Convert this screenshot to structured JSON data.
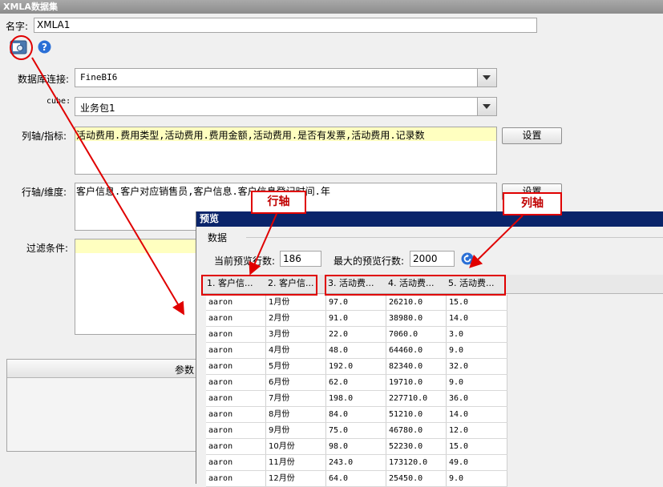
{
  "window": {
    "title": "XMLA数据集"
  },
  "name_field": {
    "label": "名字:",
    "value": "XMLA1"
  },
  "form": {
    "db_label": "数据库连接:",
    "db_value": "FineBI6",
    "cube_label": "cube:",
    "cube_value": "业务包1",
    "columns_label": "列轴/指标:",
    "columns_value": "活动费用.费用类型,活动费用.费用金额,活动费用.是否有发票,活动费用.记录数",
    "rows_label": "行轴/维度:",
    "rows_value": "客户信息.客户对应销售员,客户信息.客户信息登记时间.年",
    "filter_label": "过滤条件:",
    "settings_label": "设置",
    "params_label": "参数"
  },
  "preview": {
    "title": "预览",
    "group_label": "数据",
    "current_rows_label": "当前预览行数:",
    "current_rows_value": "186",
    "max_rows_label": "最大的预览行数:",
    "max_rows_value": "2000",
    "columns": [
      "1. 客户信...",
      "2. 客户信...",
      "3. 活动费...",
      "4. 活动费...",
      "5. 活动费..."
    ],
    "rows": [
      [
        "aaron",
        "1月份",
        "97.0",
        "26210.0",
        "15.0"
      ],
      [
        "aaron",
        "2月份",
        "91.0",
        "38980.0",
        "14.0"
      ],
      [
        "aaron",
        "3月份",
        "22.0",
        "7060.0",
        "3.0"
      ],
      [
        "aaron",
        "4月份",
        "48.0",
        "64460.0",
        "9.0"
      ],
      [
        "aaron",
        "5月份",
        "192.0",
        "82340.0",
        "32.0"
      ],
      [
        "aaron",
        "6月份",
        "62.0",
        "19710.0",
        "9.0"
      ],
      [
        "aaron",
        "7月份",
        "198.0",
        "227710.0",
        "36.0"
      ],
      [
        "aaron",
        "8月份",
        "84.0",
        "51210.0",
        "14.0"
      ],
      [
        "aaron",
        "9月份",
        "75.0",
        "46780.0",
        "12.0"
      ],
      [
        "aaron",
        "10月份",
        "98.0",
        "52230.0",
        "15.0"
      ],
      [
        "aaron",
        "11月份",
        "243.0",
        "173120.0",
        "49.0"
      ],
      [
        "aaron",
        "12月份",
        "64.0",
        "25450.0",
        "9.0"
      ]
    ]
  },
  "annotations": {
    "row_axis": "行轴",
    "column_axis": "列轴",
    "color": "#e00000"
  },
  "icons": [
    "preview-icon",
    "help-icon",
    "refresh-icon"
  ]
}
